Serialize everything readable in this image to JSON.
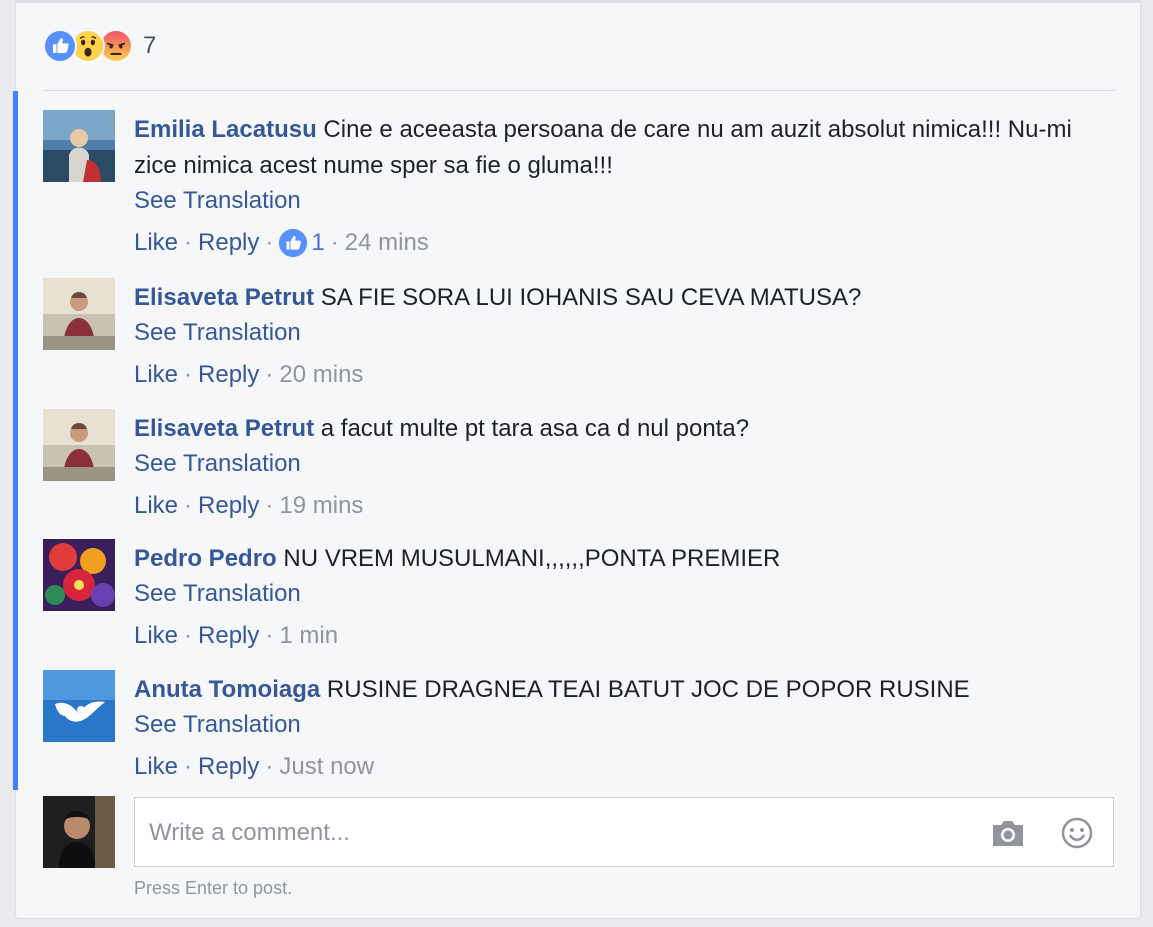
{
  "reactions": {
    "types": [
      "like-icon",
      "wow-icon",
      "angry-icon"
    ],
    "count": "7"
  },
  "comments": [
    {
      "author": "Emilia Lacatusu",
      "text": "Cine e aceeasta persoana de care nu am auzit absolut nimica!!! Nu-mi zice nimica acest nume sper sa fie o gluma!!!",
      "see_translation": "See Translation",
      "like_label": "Like",
      "reply_label": "Reply",
      "like_count": "1",
      "time": "24 mins"
    },
    {
      "author": "Elisaveta Petrut",
      "text": "SA FIE SORA LUI IOHANIS SAU CEVA MATUSA?",
      "see_translation": "See Translation",
      "like_label": "Like",
      "reply_label": "Reply",
      "time": "20 mins"
    },
    {
      "author": "Elisaveta Petrut",
      "text": "a facut multe pt tara asa ca d nul ponta?",
      "see_translation": "See Translation",
      "like_label": "Like",
      "reply_label": "Reply",
      "time": "19 mins"
    },
    {
      "author": "Pedro Pedro",
      "text": "NU VREM MUSULMANI,,,,,,PONTA PREMIER",
      "see_translation": "See Translation",
      "like_label": "Like",
      "reply_label": "Reply",
      "time": "1 min"
    },
    {
      "author": "Anuta Tomoiaga",
      "text": "RUSINE DRAGNEA TEAI BATUT JOC DE POPOR RUSINE",
      "see_translation": "See Translation",
      "like_label": "Like",
      "reply_label": "Reply",
      "time": "Just now"
    }
  ],
  "composer": {
    "placeholder": "Write a comment...",
    "hint": "Press Enter to post.",
    "icons": [
      "camera-icon",
      "emoji-icon"
    ]
  },
  "colors": {
    "author": "#365899",
    "accent_bar": "#4080ff",
    "meta_gray": "#90949c"
  }
}
